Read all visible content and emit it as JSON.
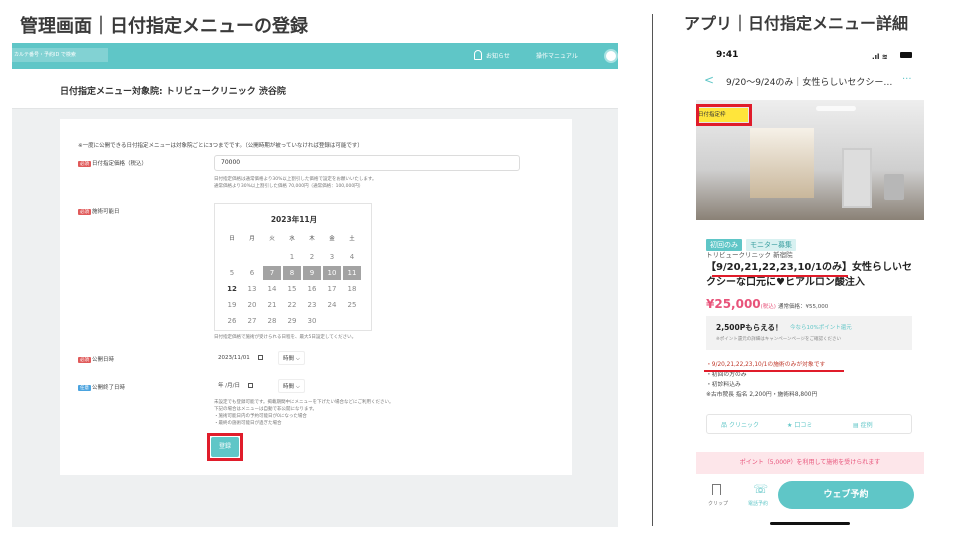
{
  "slide": {
    "left_title": "管理画面｜日付指定メニューの登録",
    "right_title": "アプリ｜日付指定メニュー詳細"
  },
  "admin": {
    "header": {
      "breadcrumb": "カルテ番号・予約ID で検索",
      "news": "お知らせ",
      "manual": "操作マニュアル"
    },
    "page_title": "日付指定メニュー対象院: トリビュークリニック 渋谷院",
    "top_note": "※一度に公開できる日付指定メニューは対象院ごとに3つまでです。（公開時期が被っていなければ登録は可能です）",
    "price": {
      "badge": "必須",
      "label": "日付指定価格（税込）",
      "value": "70000",
      "help1": "日付指定価格は通常価格より30%以上割引した価格で設定をお願いいたします。",
      "help2": "通常価格より30%以上割引した価格 70,000円（通常価格：100,000円）"
    },
    "dates": {
      "badge": "必須",
      "label": "施術可能日",
      "month": "2023年11月",
      "weekdays": [
        "日",
        "月",
        "火",
        "水",
        "木",
        "金",
        "土"
      ],
      "help": "日付指定価格で施術が受けられる日程を、最大5日設定してください。",
      "selected_days": [
        7,
        8,
        9,
        10,
        11
      ],
      "today": 12
    },
    "publish": {
      "badge": "必須",
      "label": "公開日時",
      "date": "2023/11/01",
      "time": "時間"
    },
    "end": {
      "badge": "任意",
      "label": "公開終了日時",
      "date": "年 /月/日",
      "time": "時間",
      "help1": "未設定でも登録可能です。掲載期間中にメニューを下げたい場合などにご利用ください。",
      "help2": "下記の場合はメニューは自動で非公開になります。",
      "help3": "・施術可能日内の予約可能日が0になった場合",
      "help4": "・最終の施術可能日が過ぎた場合"
    },
    "submit_label": "登録"
  },
  "phone": {
    "time": "9:41",
    "nav_title": "9/20〜9/24のみ｜女性らしいセクシー…",
    "photo_badge": "日付指定枠",
    "tag_first": "初回のみ",
    "tag_monitor": "モニター募集",
    "clinic": "トリビュークリニック 新宿院",
    "headline": "【9/20,21,22,23,10/1のみ】女性らしいセクシーな口元に♥ヒアルロン酸注入",
    "price": "¥25,000",
    "price_tax": "(税込)",
    "price_regular": "通常価格：¥55,000",
    "points_main": "2,500Pもらえる！",
    "points_sub": "今なら10%ポイント還元",
    "points_note": "※ポイント還元の詳細はキャンペーンページをご確認ください",
    "cond1": "・9/20,21,22,23,10/1の施術のみが対象です",
    "cond2": "・初回の方のみ",
    "cond3": "・初診料込み",
    "cond4": "※古市院長 指名 2,200円・施術料8,800円",
    "act_clinic": "クリニック",
    "act_reviews": "口コミ",
    "act_cases": "症例",
    "points_banner": "ポイント（5,000P）を利用して施術を受けられます",
    "bottom_clip": "クリップ",
    "bottom_phone": "電話予約",
    "web_reserve": "ウェブ予約"
  },
  "colors": {
    "accent": "#5fc6c7",
    "highlight": "#e01c2a",
    "price_pink": "#e8537a"
  }
}
